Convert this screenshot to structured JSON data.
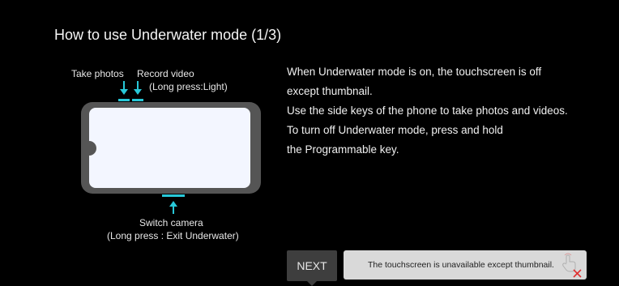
{
  "title": "How to use Underwater mode (1/3)",
  "diagram": {
    "take_photos": "Take photos",
    "record_video": "Record video",
    "record_video_sub": "(Long press:Light)",
    "switch_camera": "Switch camera",
    "switch_camera_sub": "(Long press : Exit Underwater)"
  },
  "description": [
    "When Underwater mode is on, the touchscreen is off",
    "except thumbnail.",
    "Use the side keys of the phone to take photos and videos.",
    "To turn off Underwater mode, press and hold",
    "the Programmable key."
  ],
  "next_label": "NEXT",
  "toast": {
    "text": "The touchscreen is unavailable except thumbnail.",
    "icon": "touch-disabled-icon"
  },
  "colors": {
    "accent": "#28c8d8",
    "phone_body": "#555555",
    "phone_screen": "#f3f6ff"
  }
}
